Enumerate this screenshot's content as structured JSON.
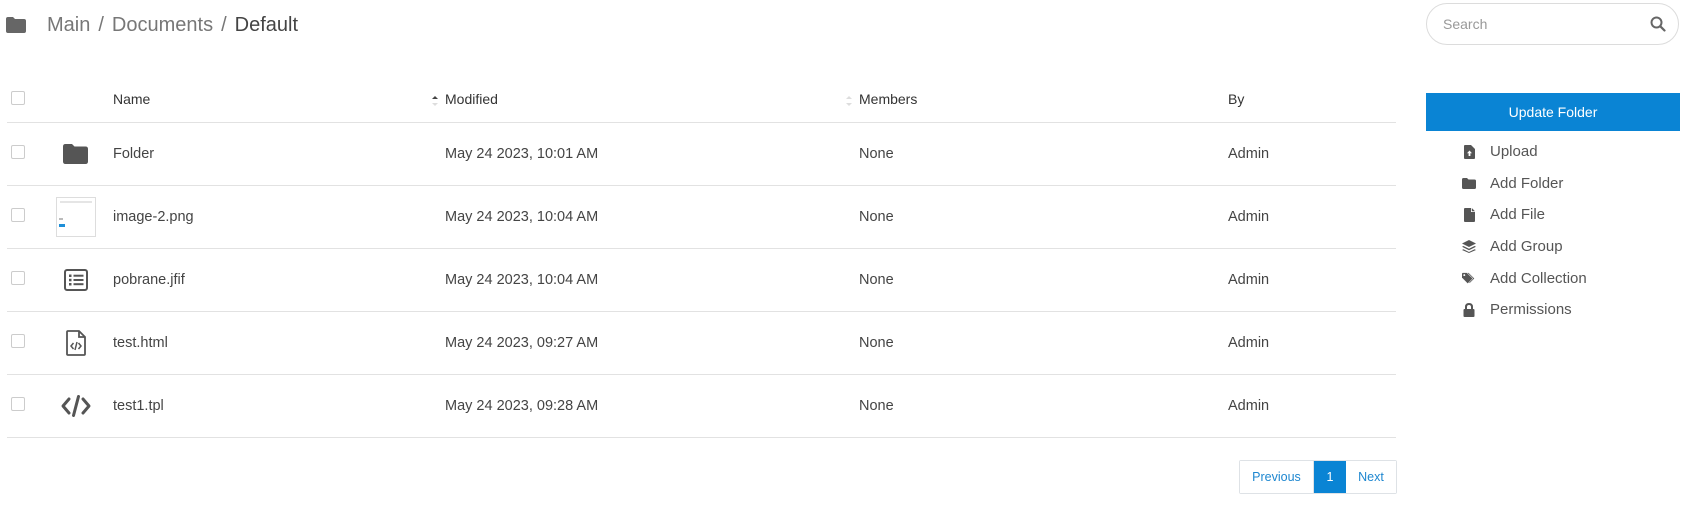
{
  "breadcrumb": {
    "items": [
      "Main",
      "Documents",
      "Default"
    ],
    "separator": "/"
  },
  "search": {
    "placeholder": "Search"
  },
  "table": {
    "columns": {
      "name": "Name",
      "modified": "Modified",
      "members": "Members",
      "by": "By"
    },
    "rows": [
      {
        "icon": "folder-icon",
        "name": "Folder",
        "modified": "May 24 2023, 10:01 AM",
        "members": "None",
        "by": "Admin"
      },
      {
        "icon": "image-thumbnail",
        "name": "image-2.png",
        "modified": "May 24 2023, 10:04 AM",
        "members": "None",
        "by": "Admin"
      },
      {
        "icon": "list-alt-icon",
        "name": "pobrane.jfif",
        "modified": "May 24 2023, 10:04 AM",
        "members": "None",
        "by": "Admin"
      },
      {
        "icon": "file-code-icon",
        "name": "test.html",
        "modified": "May 24 2023, 09:27 AM",
        "members": "None",
        "by": "Admin"
      },
      {
        "icon": "code-icon",
        "name": "test1.tpl",
        "modified": "May 24 2023, 09:28 AM",
        "members": "None",
        "by": "Admin"
      }
    ]
  },
  "pagination": {
    "previous": "Previous",
    "current": "1",
    "next": "Next"
  },
  "sidebar": {
    "update_button": "Update Folder",
    "actions": [
      {
        "label": "Upload",
        "icon": "file-upload-icon"
      },
      {
        "label": "Add Folder",
        "icon": "folder-icon"
      },
      {
        "label": "Add File",
        "icon": "file-icon"
      },
      {
        "label": "Add Group",
        "icon": "layers-icon"
      },
      {
        "label": "Add Collection",
        "icon": "tags-icon"
      },
      {
        "label": "Permissions",
        "icon": "lock-icon"
      }
    ]
  },
  "colors": {
    "accent": "#0a84d4",
    "icon": "#555555",
    "border": "#e2e2e2"
  }
}
